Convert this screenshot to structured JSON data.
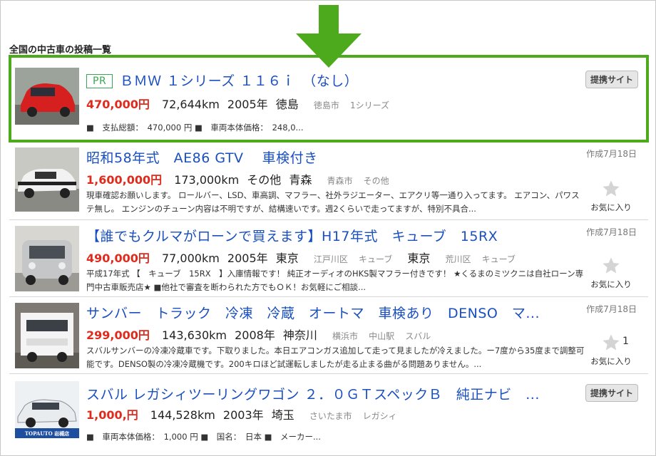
{
  "heading": "全国の中古車の投稿一覧",
  "listings": [
    {
      "pr": "PR",
      "title": "ＢＭＷ １シリーズ １１６ｉ　（なし）",
      "price": "470,000円",
      "mileage": "72,644km",
      "year": "2005年",
      "pref": "徳島",
      "city": "徳島市",
      "model": "1シリーズ",
      "specs": "■　支払総額：　470,000 円 ■　車両本体価格：　248,0...",
      "badge": "提携サイト"
    },
    {
      "title": "昭和58年式　AE86 GTV　 車検付き",
      "price": "1,600,000円",
      "mileage": "173,000km",
      "year": "その他",
      "pref": "青森",
      "city": "青森市",
      "model": "その他",
      "desc": "現車確認お願いします。 ロールバー、LSD、車高調、マフラー、社外ラジエーター、エアクリ等一通り入ってます。 エアコン、パワステ無し。 エンジンのチューン内容は不明ですが、結構速いです。週2くらいで走ってますが、特別不具合...",
      "date": "作成7月18日",
      "fav_label": "お気に入り",
      "fav_count": ""
    },
    {
      "title": "【誰でもクルマがローンで買えます】H17年式　キューブ　15RX",
      "price": "490,000円",
      "mileage": "77,000km",
      "year": "2005年",
      "pref": "東京",
      "city": "江戸川区",
      "model": "キューブ",
      "pref2": "東京",
      "city2": "荒川区",
      "model2": "キューブ",
      "desc": "平成17年式 【　キューブ　15RX　】入庫情報です！ 純正オーディオのHKS製マフラー付きです！ ★くるまのミツクニは自社ローン専門中古車販売店★ ■他社で審査を断わられた方でもＯＫ！お気軽にご相談...",
      "date": "作成7月18日",
      "fav_label": "お気に入り",
      "fav_count": ""
    },
    {
      "title": "サンバー　トラック　冷凍　冷蔵　オートマ　車検あり　DENSO　マ...",
      "price": "299,000円",
      "mileage": "143,630km",
      "year": "2008年",
      "pref": "神奈川",
      "city": "横浜市",
      "station": "中山駅",
      "model": "スバル",
      "desc": "スバルサンバーの冷凍冷蔵車です。下取りました。本日エアコンガス追加して走って見ましたが冷えました。ー7度から35度まで調整可能です。DENSO製の冷凍冷蔵機です。200キロほど試運転しましたが走る止まる曲がる問題ありません。...",
      "date": "作成7月18日",
      "fav_label": "お気に入り",
      "fav_count": "1"
    },
    {
      "title": "スバル レガシィツーリングワゴン ２．０ＧＴスペックＢ　純正ナビ　...",
      "price": "1,000,円",
      "mileage": "144,528km",
      "year": "2003年",
      "pref": "埼玉",
      "city": "さいたま市",
      "model": "レガシィ",
      "specs": "■　車両本体価格：　1,000 円 ■　国名：　日本 ■　メーカー...",
      "badge": "提携サイト",
      "thumb_text": "TOPAUTO 岩槻店"
    }
  ],
  "colors": {
    "accent": "#4caa1c",
    "link": "#1a4fbf",
    "price": "#e02a1c"
  }
}
